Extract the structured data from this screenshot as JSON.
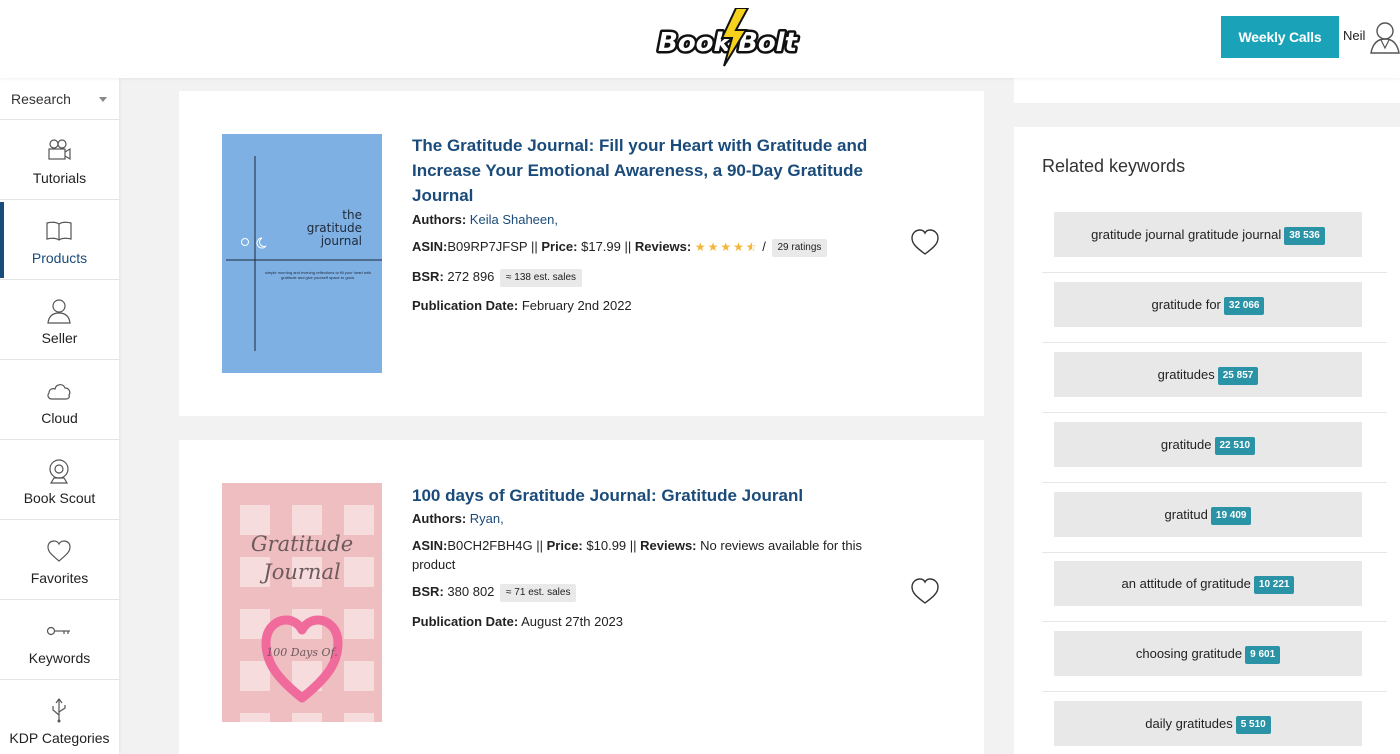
{
  "header": {
    "logo_text": "Book Bolt",
    "weekly_calls_label": "Weekly Calls",
    "user_name": "Neil"
  },
  "sidebar": {
    "dropdown_value": "Research",
    "items": [
      {
        "label": "Tutorials",
        "icon": "video-camera-icon"
      },
      {
        "label": "Products",
        "icon": "open-book-icon",
        "active": true
      },
      {
        "label": "Seller",
        "icon": "user-icon"
      },
      {
        "label": "Cloud",
        "icon": "cloud-icon"
      },
      {
        "label": "Book Scout",
        "icon": "webcam-icon"
      },
      {
        "label": "Favorites",
        "icon": "heart-icon"
      },
      {
        "label": "Keywords",
        "icon": "key-icon"
      },
      {
        "label": "KDP Categories",
        "icon": "usb-icon"
      }
    ]
  },
  "products": [
    {
      "title": "The Gratitude Journal: Fill your Heart with Gratitude and Increase Your Emotional Awareness, a 90-Day Gratitude Journal",
      "authors_label": "Authors:",
      "author": "Keila Shaheen,",
      "asin_label": "ASIN:",
      "asin": "B09RP7JFSP",
      "price_label": "Price:",
      "price": "$17.99",
      "reviews_label": "Reviews:",
      "rating": 4.5,
      "ratings_count": "29 ratings",
      "bsr_label": "BSR:",
      "bsr": "272 896",
      "est_sales": "≈ 138 est. sales",
      "pub_label": "Publication Date:",
      "pub_date": "February 2nd 2022",
      "cover": {
        "line1": "the",
        "line2": "gratitude",
        "line3": "journal",
        "small": "simple morning and evening reflections to fill your heart with gratitude and give yourself space to grow.",
        "bg": "#7fb0e3"
      }
    },
    {
      "title": "100 days of Gratitude Journal: Gratitude Jouranl",
      "authors_label": "Authors:",
      "author": "Ryan,",
      "asin_label": "ASIN:",
      "asin": "B0CH2FBH4G",
      "price_label": "Price:",
      "price": "$10.99",
      "reviews_label": "Reviews:",
      "reviews_text": "No reviews available for this product",
      "bsr_label": "BSR:",
      "bsr": "380 802",
      "est_sales": "≈ 71 est. sales",
      "pub_label": "Publication Date:",
      "pub_date": "August 27th 2023",
      "cover": {
        "line1": "Gratitude",
        "line2": "Journal",
        "heart_text": "100 Days Of.",
        "bg": "#f2c9cc"
      }
    }
  ],
  "related": {
    "title": "Related keywords",
    "keywords": [
      {
        "text": "gratitude journal gratitude journal",
        "count": "38 536"
      },
      {
        "text": "gratitude for",
        "count": "32 066"
      },
      {
        "text": "gratitudes",
        "count": "25 857"
      },
      {
        "text": "gratitude",
        "count": "22 510"
      },
      {
        "text": "gratitud",
        "count": "19 409"
      },
      {
        "text": "an attitude of gratitude",
        "count": "10 221"
      },
      {
        "text": "choosing gratitude",
        "count": "9 601"
      },
      {
        "text": "daily gratitudes",
        "count": "5 510"
      }
    ]
  },
  "colors": {
    "accent": "#1aa3b8",
    "title_blue": "#1a4b7a",
    "count_badge": "#2a93a6",
    "star": "#f4b63a"
  }
}
